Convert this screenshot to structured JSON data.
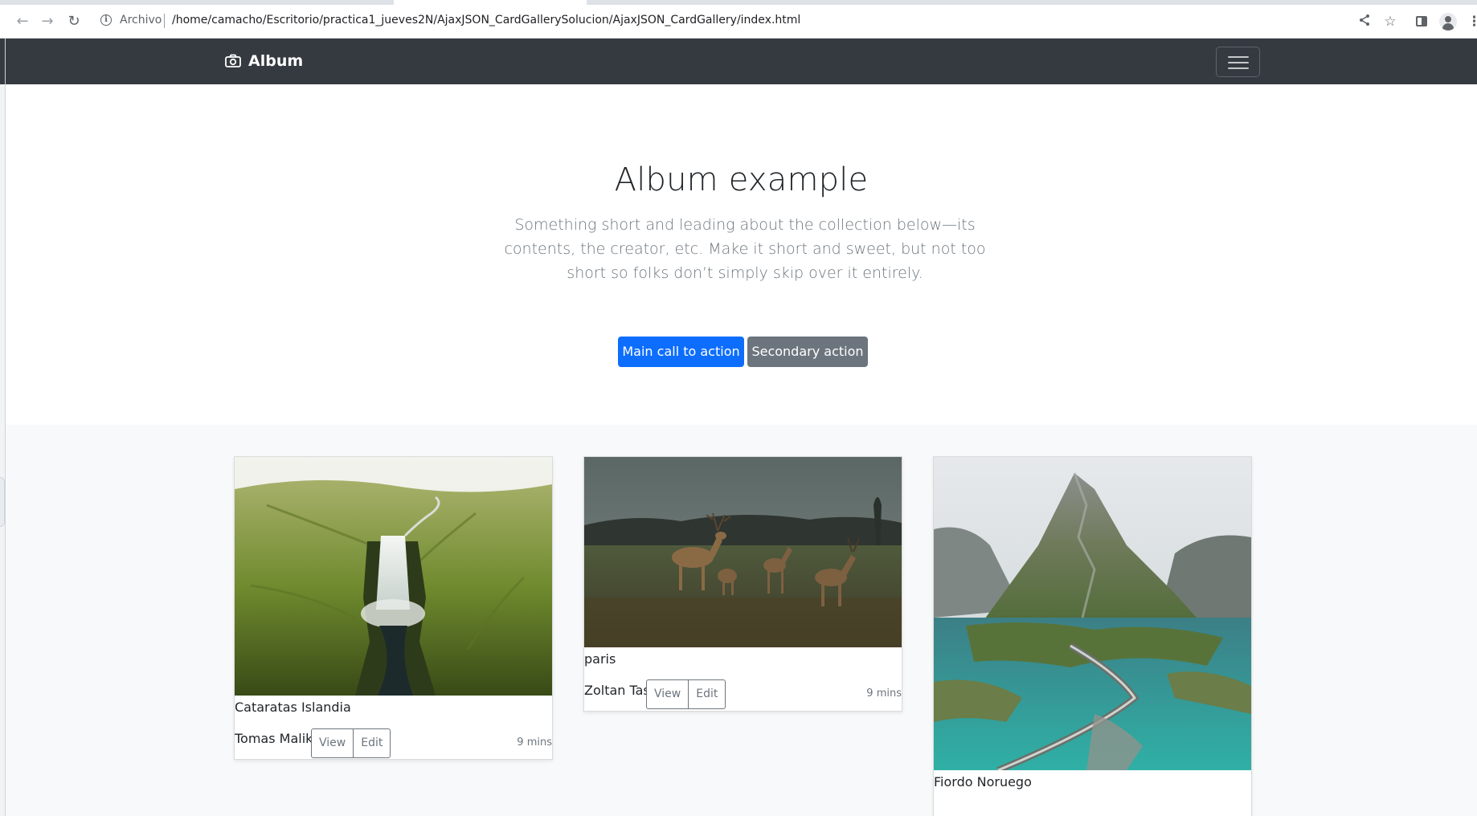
{
  "browser": {
    "security_label": "Archivo",
    "url": "/home/camacho/Escritorio/practica1_jueves2N/AjaxJSON_CardGallerySolucion/AjaxJSON_CardGallery/index.html"
  },
  "navbar": {
    "brand": "Album"
  },
  "hero": {
    "title": "Album example",
    "lead": "Something short and leading about the collection below—its contents, the creator, etc. Make it short and sweet, but not too short so folks don’t simply skip over it entirely.",
    "primary_button": "Main call to action",
    "secondary_button": "Secondary action"
  },
  "cards": [
    {
      "image": "waterfall-photo",
      "title": "Cataratas Islandia",
      "author": "Tomas Malik",
      "view_label": "View",
      "edit_label": "Edit",
      "time": "9 mins"
    },
    {
      "image": "deer-photo",
      "title": "paris",
      "author": "Zoltan Tasi",
      "view_label": "View",
      "edit_label": "Edit",
      "time": "9 mins"
    },
    {
      "image": "mountain-fjord-photo",
      "title": "Fiordo Noruego"
    }
  ],
  "colors": {
    "navbar_bg": "#343a40",
    "primary": "#0d6efd",
    "secondary": "#6c757d",
    "album_bg": "#f8f9fa"
  }
}
